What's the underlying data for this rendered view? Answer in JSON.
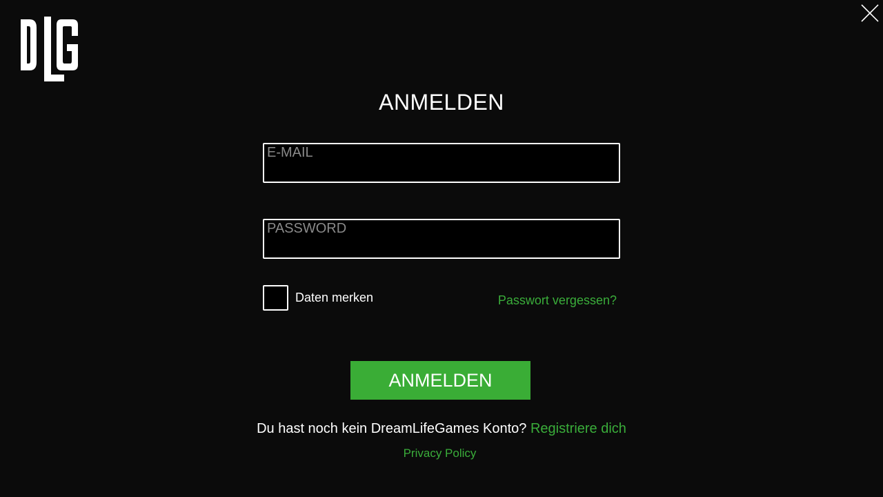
{
  "logo": {
    "text": "DLG",
    "icon": "dlg-logo"
  },
  "close": {
    "icon": "close-icon"
  },
  "title": "ANMELDEN",
  "form": {
    "email_placeholder": "E-MAIL",
    "email_value": "",
    "password_placeholder": "PASSWORD",
    "password_value": "",
    "remember_label": "Daten merken",
    "remember_checked": false,
    "forgot_label": "Passwort vergessen?",
    "submit_label": "ANMELDEN"
  },
  "footer": {
    "register_prompt": "Du hast noch kein DreamLifeGames Konto?",
    "register_link": "Registriere dich",
    "privacy_label": "Privacy Policy"
  },
  "colors": {
    "background": "#0b0b0b",
    "accent": "#3aad36",
    "field_bg": "#000000",
    "placeholder": "#8a8a8a"
  }
}
